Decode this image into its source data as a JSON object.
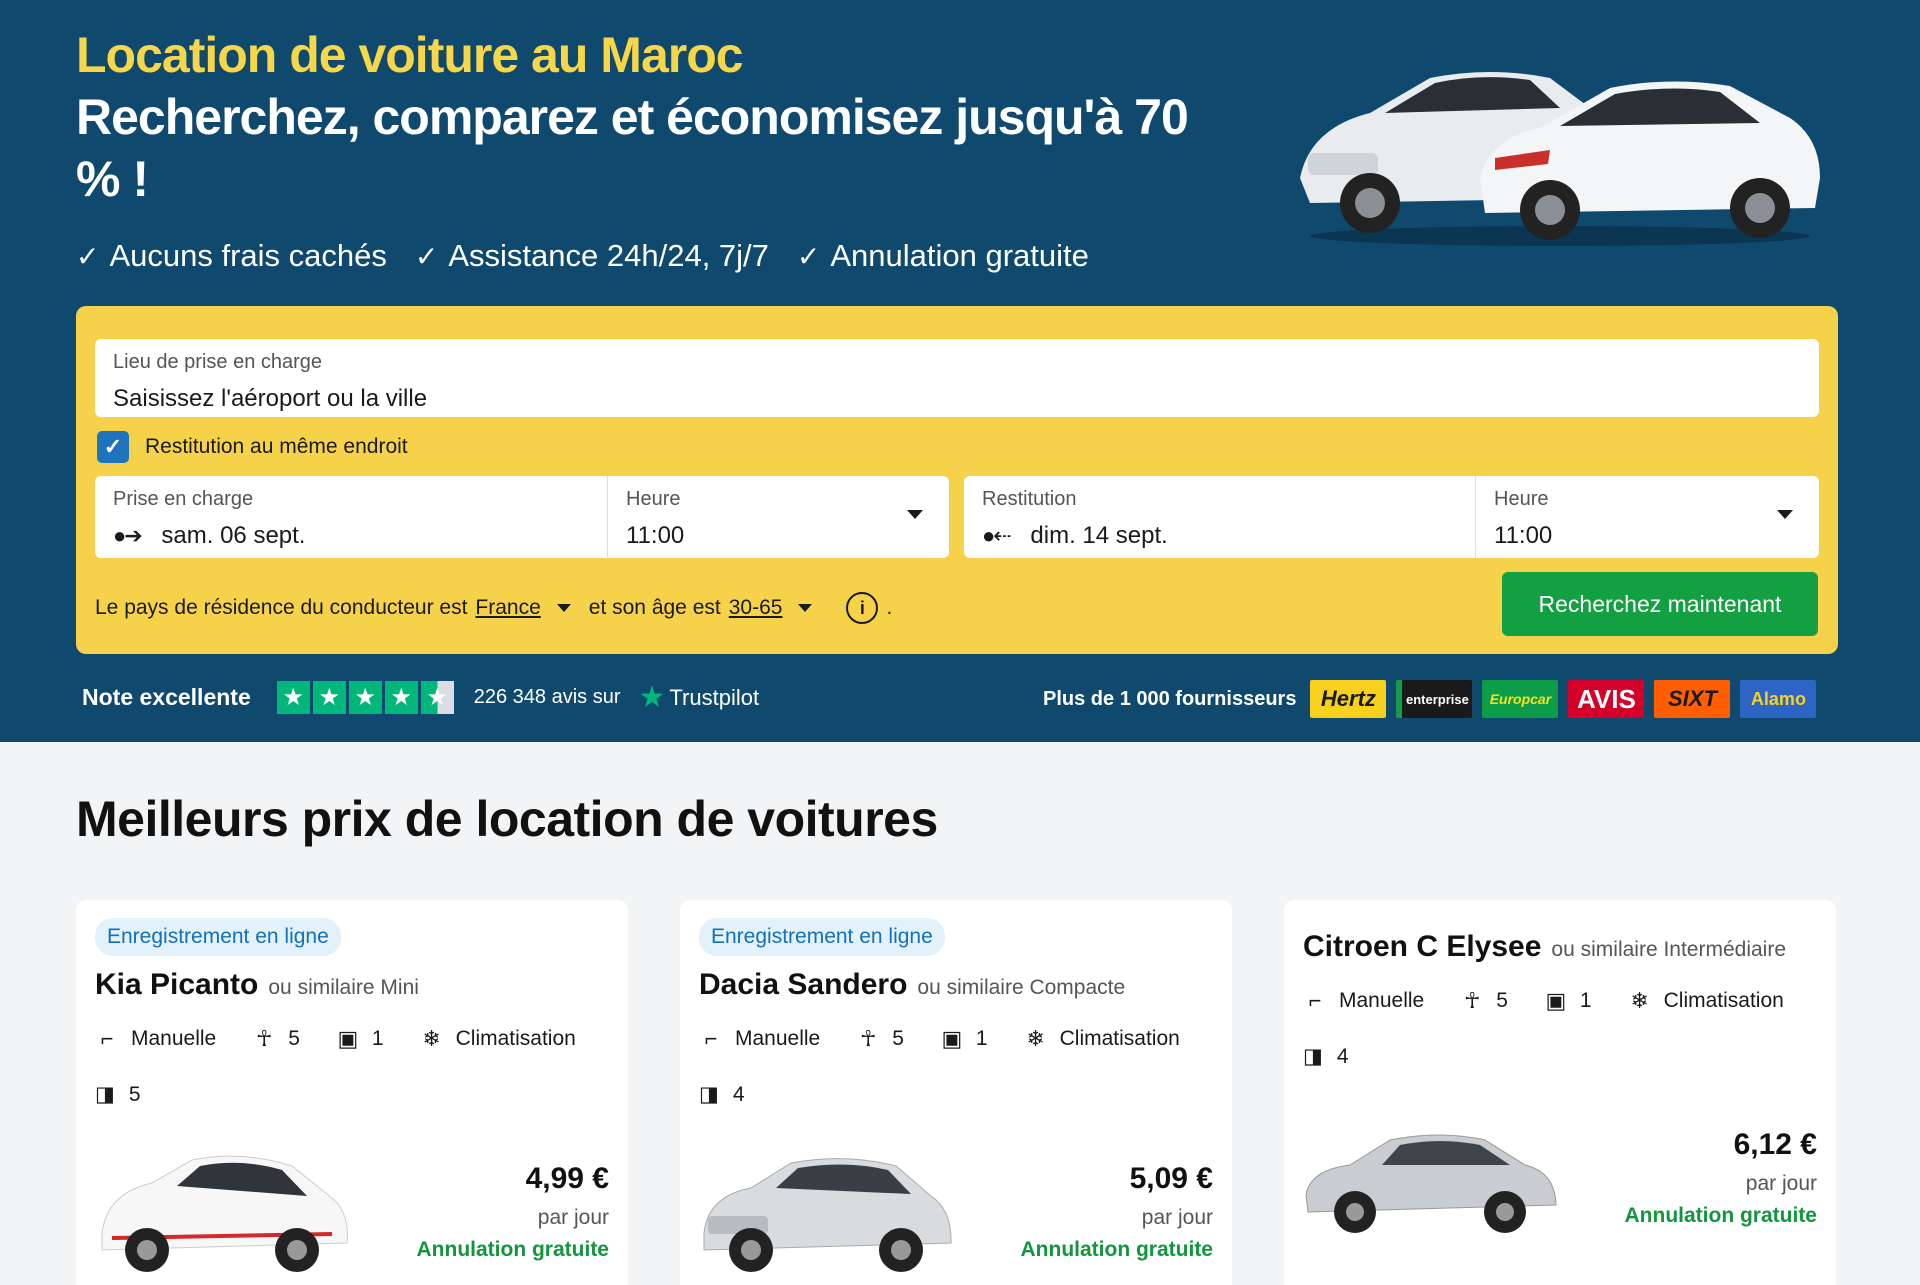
{
  "hero": {
    "title": "Location de voiture au Maroc",
    "subtitle": "Recherchez, comparez et économisez jusqu'à 70 % !",
    "features": [
      "Aucuns frais cachés",
      "Assistance 24h/24, 7j/7",
      "Annulation gratuite"
    ]
  },
  "search": {
    "location_label": "Lieu de prise en charge",
    "location_placeholder": "Saisissez l'aéroport ou la ville",
    "same_place_label": "Restitution au même endroit",
    "same_place_checked": true,
    "pickup_label": "Prise en charge",
    "pickup_date": "sam. 06 sept.",
    "pickup_time_label": "Heure",
    "pickup_time": "11:00",
    "return_label": "Restitution",
    "return_date": "dim. 14 sept.",
    "return_time_label": "Heure",
    "return_time": "11:00",
    "driver_text_1": "Le pays de résidence du conducteur est",
    "driver_country": "France",
    "driver_text_2": "et son âge est",
    "driver_age": "30-65",
    "driver_end": ".",
    "button_label": "Recherchez maintenant"
  },
  "rating": {
    "label": "Note excellente",
    "stars": 4.5,
    "reviews": "226 348 avis sur",
    "provider": "Trustpilot"
  },
  "suppliers": {
    "label": "Plus de 1 000 fournisseurs",
    "logos": [
      "Hertz",
      "enterprise",
      "Europcar",
      "AVIS",
      "SIXT",
      "Alamo"
    ]
  },
  "offers": {
    "title": "Meilleurs prix de location de voitures",
    "cards": [
      {
        "badge": "Enregistrement en ligne",
        "name": "Kia Picanto",
        "similar": "ou similaire Mini",
        "transmission": "Manuelle",
        "seats": "5",
        "bags": "1",
        "ac": "Climatisation",
        "doors": "5",
        "price": "4,99 €",
        "per": "par jour",
        "cancel": "Annulation gratuite"
      },
      {
        "badge": "Enregistrement en ligne",
        "name": "Dacia Sandero",
        "similar": "ou similaire Compacte",
        "transmission": "Manuelle",
        "seats": "5",
        "bags": "1",
        "ac": "Climatisation",
        "doors": "4",
        "price": "5,09 €",
        "per": "par jour",
        "cancel": "Annulation gratuite"
      },
      {
        "badge": "",
        "name": "Citroen C Elysee",
        "similar": "ou similaire Intermédiaire",
        "transmission": "Manuelle",
        "seats": "5",
        "bags": "1",
        "ac": "Climatisation",
        "doors": "4",
        "price": "6,12 €",
        "per": "par jour",
        "cancel": "Annulation gratuite"
      }
    ]
  },
  "colors": {
    "hero_bg": "#0f4a6e",
    "accent_yellow": "#f7d64a",
    "search_bg": "#f6d24a",
    "cta_green": "#13a043",
    "trustpilot_green": "#00b67a"
  }
}
